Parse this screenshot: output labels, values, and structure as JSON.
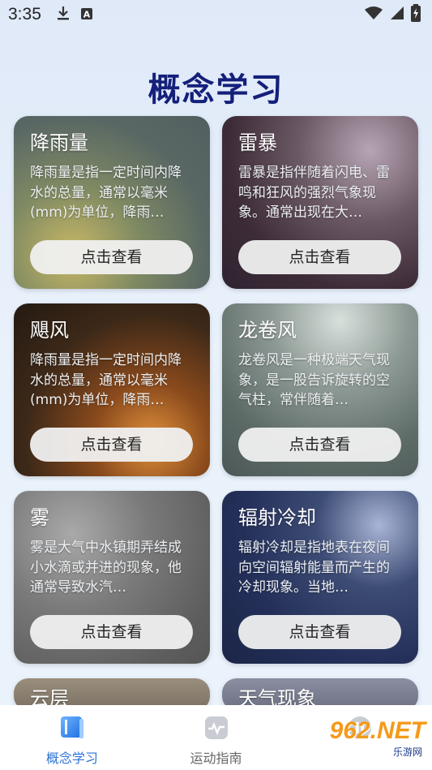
{
  "status_bar": {
    "time": "3:35",
    "icons_left": [
      "download-icon",
      "a-box-icon"
    ],
    "icons_right": [
      "wifi-icon",
      "signal-icon",
      "battery-charging-icon"
    ]
  },
  "page": {
    "title": "概念学习"
  },
  "cards": [
    {
      "title": "降雨量",
      "desc": "降雨量是指一定时间内降水的总量，通常以毫米(mm)为单位，降雨…",
      "button": "点击查看"
    },
    {
      "title": "雷暴",
      "desc": "雷暴是指伴随着闪电、雷鸣和狂风的强烈气象现象。通常出现在大…",
      "button": "点击查看"
    },
    {
      "title": "飓风",
      "desc": "降雨量是指一定时间内降水的总量，通常以毫米(mm)为单位，降雨…",
      "button": "点击查看"
    },
    {
      "title": "龙卷风",
      "desc": "龙卷风是一种极端天气现象，是一股告诉旋转的空气柱，常伴随着…",
      "button": "点击查看"
    },
    {
      "title": "雾",
      "desc": "雾是大气中水镇期弄结成小水滴或并进的现象，他通常导致水汽…",
      "button": "点击查看"
    },
    {
      "title": "辐射冷却",
      "desc": "辐射冷却是指地表在夜间向空间辐射能量而产生的冷却现象。当地…",
      "button": "点击查看"
    },
    {
      "title": "云层"
    },
    {
      "title": "天气现象"
    }
  ],
  "bottom_nav": {
    "items": [
      {
        "label": "概念学习",
        "icon": "book-icon",
        "active": true
      },
      {
        "label": "运动指南",
        "icon": "pulse-icon",
        "active": false
      },
      {
        "label": "",
        "icon": "pause-icon",
        "active": false
      }
    ]
  },
  "watermark": {
    "main": "962.NET",
    "sub": "乐游网"
  },
  "colors": {
    "title": "#14207a",
    "accent": "#2d74d6",
    "button_bg": "#f0f0f0"
  }
}
